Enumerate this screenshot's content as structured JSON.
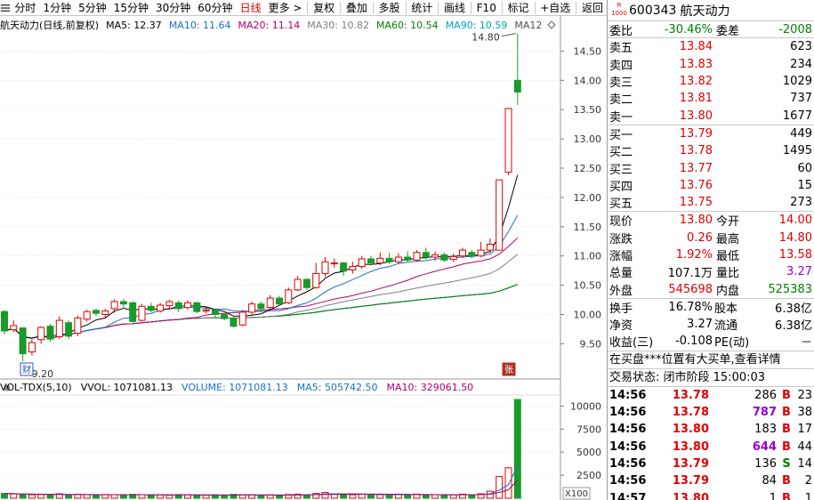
{
  "toolbar": {
    "tabs": [
      "分时",
      "1分钟",
      "5分钟",
      "15分钟",
      "30分钟",
      "60分钟",
      "日线",
      "更多 >"
    ],
    "active_tab": "日线",
    "buttons": [
      "复权",
      "叠加",
      "多股",
      "统计",
      "画线",
      "F10",
      "标记",
      "+自选",
      "返回"
    ]
  },
  "chart_info": {
    "name": "航天动力(日线,前复权)",
    "ma5": "MA5: 12.37",
    "ma10": "MA10: 11.64",
    "ma20": "MA20: 11.14",
    "ma30": "MA30: 10.82",
    "ma60": "MA60: 10.54",
    "ma90": "MA90: 10.59",
    "ma120": "MA12"
  },
  "vol_info": {
    "label": "VOL-TDX(5,10)",
    "vvol": "VVOL: 1071081.13",
    "volume": "VOLUME: 1071081.13",
    "ma5": "MA5: 505742.50",
    "ma10": "MA10: 329061.50"
  },
  "colors": {
    "up": "#e00000",
    "down": "#1a9a2a",
    "ma5": "#000000",
    "ma10": "#1a6fc8",
    "ma20": "#b0006f",
    "ma30": "#7f7f7f",
    "ma60": "#008000",
    "ma90": "#00a0c0",
    "ma120": "#505050"
  },
  "annotations": {
    "high": "14.80",
    "low": "9.20",
    "cai_badge": "财",
    "zhang_badge": "张"
  },
  "chart_data": {
    "type": "candlestick",
    "price_axis": {
      "ticks": [
        9.5,
        10.0,
        10.5,
        11.0,
        11.5,
        12.0,
        12.5,
        13.0,
        13.5,
        14.0,
        14.5
      ],
      "labels": [
        "9.50",
        "10.00",
        "10.50",
        "11.00",
        "11.50",
        "12.00",
        "12.50",
        "13.00",
        "13.50",
        "14.00",
        "14.50"
      ]
    },
    "volume_axis": {
      "ticks": [
        2500,
        5000,
        7500,
        10000
      ],
      "labels": [
        "2500",
        "5000",
        "7500",
        "10000"
      ],
      "unit": "X100"
    },
    "candles": [
      [
        10.05,
        9.72,
        10.08,
        9.66
      ],
      [
        9.74,
        9.81,
        9.9,
        9.7
      ],
      [
        9.77,
        9.33,
        9.78,
        9.2
      ],
      [
        9.36,
        9.52,
        9.58,
        9.3
      ],
      [
        9.57,
        9.78,
        9.8,
        9.5
      ],
      [
        9.8,
        9.58,
        9.84,
        9.53
      ],
      [
        9.62,
        9.9,
        9.97,
        9.58
      ],
      [
        9.86,
        9.63,
        9.9,
        9.58
      ],
      [
        9.68,
        9.94,
        9.98,
        9.63
      ],
      [
        9.92,
        10.05,
        10.08,
        9.88
      ],
      [
        10.07,
        10.02,
        10.1,
        9.97
      ],
      [
        10.0,
        10.06,
        10.1,
        9.95
      ],
      [
        10.1,
        10.22,
        10.26,
        10.03
      ],
      [
        10.22,
        10.18,
        10.27,
        10.1
      ],
      [
        10.2,
        9.88,
        10.22,
        9.86
      ],
      [
        9.9,
        10.14,
        10.18,
        9.88
      ],
      [
        10.14,
        10.07,
        10.2,
        10.04
      ],
      [
        10.06,
        10.16,
        10.2,
        10.03
      ],
      [
        10.15,
        10.22,
        10.25,
        10.1
      ],
      [
        10.2,
        10.1,
        10.24,
        10.04
      ],
      [
        10.12,
        10.2,
        10.24,
        10.08
      ],
      [
        10.2,
        10.05,
        10.22,
        10.02
      ],
      [
        10.06,
        10.08,
        10.12,
        10.02
      ],
      [
        10.08,
        10.0,
        10.1,
        9.95
      ],
      [
        10.0,
        9.93,
        10.03,
        9.9
      ],
      [
        9.94,
        9.8,
        9.96,
        9.78
      ],
      [
        9.82,
        10.04,
        10.08,
        9.8
      ],
      [
        10.04,
        10.18,
        10.22,
        10.0
      ],
      [
        10.18,
        10.1,
        10.22,
        10.06
      ],
      [
        10.12,
        10.28,
        10.33,
        10.08
      ],
      [
        10.28,
        10.18,
        10.32,
        10.15
      ],
      [
        10.2,
        10.42,
        10.46,
        10.18
      ],
      [
        10.42,
        10.6,
        10.66,
        10.4
      ],
      [
        10.6,
        10.46,
        10.62,
        10.42
      ],
      [
        10.46,
        10.7,
        10.88,
        10.44
      ],
      [
        10.7,
        10.9,
        10.98,
        10.64
      ],
      [
        10.88,
        10.88,
        10.96,
        10.8
      ],
      [
        10.88,
        10.74,
        10.9,
        10.66
      ],
      [
        10.76,
        10.82,
        10.9,
        10.7
      ],
      [
        10.82,
        10.95,
        11.0,
        10.78
      ],
      [
        10.95,
        10.88,
        11.0,
        10.84
      ],
      [
        10.88,
        10.96,
        11.06,
        10.84
      ],
      [
        10.96,
        10.9,
        11.06,
        10.86
      ],
      [
        10.9,
        10.98,
        11.05,
        10.86
      ],
      [
        10.98,
        10.93,
        11.08,
        10.9
      ],
      [
        10.93,
        11.06,
        11.1,
        10.9
      ],
      [
        11.06,
        10.98,
        11.14,
        10.94
      ],
      [
        10.98,
        11.02,
        11.08,
        10.92
      ],
      [
        11.02,
        10.93,
        11.06,
        10.9
      ],
      [
        10.94,
        10.99,
        11.04,
        10.9
      ],
      [
        11.0,
        11.1,
        11.14,
        10.96
      ],
      [
        11.06,
        11.0,
        11.1,
        10.96
      ],
      [
        11.0,
        11.1,
        11.24,
        10.98
      ],
      [
        11.1,
        11.2,
        11.3,
        11.05
      ],
      [
        11.1,
        12.3,
        12.3,
        11.1
      ],
      [
        12.43,
        13.52,
        13.52,
        12.38
      ],
      [
        14.0,
        13.8,
        14.8,
        13.58
      ]
    ],
    "volumes": [
      520,
      460,
      420,
      380,
      400,
      360,
      480,
      300,
      420,
      380,
      360,
      400,
      380,
      360,
      420,
      380,
      340,
      360,
      320,
      400,
      380,
      340,
      320,
      360,
      300,
      420,
      380,
      360,
      300,
      360,
      320,
      400,
      440,
      360,
      520,
      620,
      480,
      420,
      380,
      440,
      360,
      380,
      360,
      420,
      380,
      440,
      360,
      380,
      340,
      360,
      440,
      380,
      480,
      760,
      2350,
      3300,
      10711
    ]
  },
  "quote": {
    "code": "600343",
    "name": "航天动力",
    "badge_top": "R",
    "badge_bottom": "1000",
    "weibi_label": "委比",
    "weibi_value": "-30.46%",
    "weicha_label": "委差",
    "weicha_value": "-2008",
    "sells": [
      {
        "label": "卖五",
        "price": "13.84",
        "vol": "623"
      },
      {
        "label": "卖四",
        "price": "13.83",
        "vol": "234"
      },
      {
        "label": "卖三",
        "price": "13.82",
        "vol": "1029"
      },
      {
        "label": "卖二",
        "price": "13.81",
        "vol": "737"
      },
      {
        "label": "卖一",
        "price": "13.80",
        "vol": "1677"
      }
    ],
    "buys": [
      {
        "label": "买一",
        "price": "13.79",
        "vol": "449"
      },
      {
        "label": "买二",
        "price": "13.78",
        "vol": "1495"
      },
      {
        "label": "买三",
        "price": "13.77",
        "vol": "60"
      },
      {
        "label": "买四",
        "price": "13.76",
        "vol": "15"
      },
      {
        "label": "买五",
        "price": "13.75",
        "vol": "273"
      }
    ],
    "stats": [
      {
        "l1": "现价",
        "v1": "13.80",
        "c1": "red",
        "l2": "今开",
        "v2": "14.00",
        "c2": "red"
      },
      {
        "l1": "涨跌",
        "v1": "0.26",
        "c1": "red",
        "l2": "最高",
        "v2": "14.80",
        "c2": "red"
      },
      {
        "l1": "涨幅",
        "v1": "1.92%",
        "c1": "red",
        "l2": "最低",
        "v2": "13.58",
        "c2": "red"
      },
      {
        "l1": "总量",
        "v1": "107.1万",
        "c1": "black",
        "l2": "量比",
        "v2": "3.27",
        "c2": "purple"
      },
      {
        "l1": "外盘",
        "v1": "545698",
        "c1": "red",
        "l2": "内盘",
        "v2": "525383",
        "c2": "green"
      }
    ],
    "stats2": [
      {
        "l1": "换手",
        "v1": "16.78%",
        "l2": "股本",
        "v2": "6.38亿"
      },
      {
        "l1": "净资",
        "v1": "3.27",
        "l2": "流通",
        "v2": "6.38亿"
      },
      {
        "l1": "收益(三)",
        "v1": "-0.108",
        "l2": "PE(动)",
        "v2": "－"
      }
    ],
    "notice": "在买盘***位置有大买单,查看详情",
    "status": "交易状态: 闭市阶段 15:00:03",
    "ticks": [
      {
        "time": "14:56",
        "price": "13.78",
        "vol": "286",
        "vc": "black",
        "dir": "B",
        "n": "23"
      },
      {
        "time": "14:56",
        "price": "13.78",
        "vol": "787",
        "vc": "purple",
        "dir": "B",
        "n": "38"
      },
      {
        "time": "14:56",
        "price": "13.80",
        "vol": "183",
        "vc": "black",
        "dir": "B",
        "n": "17"
      },
      {
        "time": "14:56",
        "price": "13.80",
        "vol": "644",
        "vc": "purple",
        "dir": "B",
        "n": "44"
      },
      {
        "time": "14:56",
        "price": "13.79",
        "vol": "136",
        "vc": "black",
        "dir": "S",
        "n": "14"
      },
      {
        "time": "14:56",
        "price": "13.79",
        "vol": "84",
        "vc": "black",
        "dir": "B",
        "n": "2"
      },
      {
        "time": "14:57",
        "price": "13.80",
        "vol": "1",
        "vc": "black",
        "dir": "B",
        "n": "1"
      }
    ]
  }
}
